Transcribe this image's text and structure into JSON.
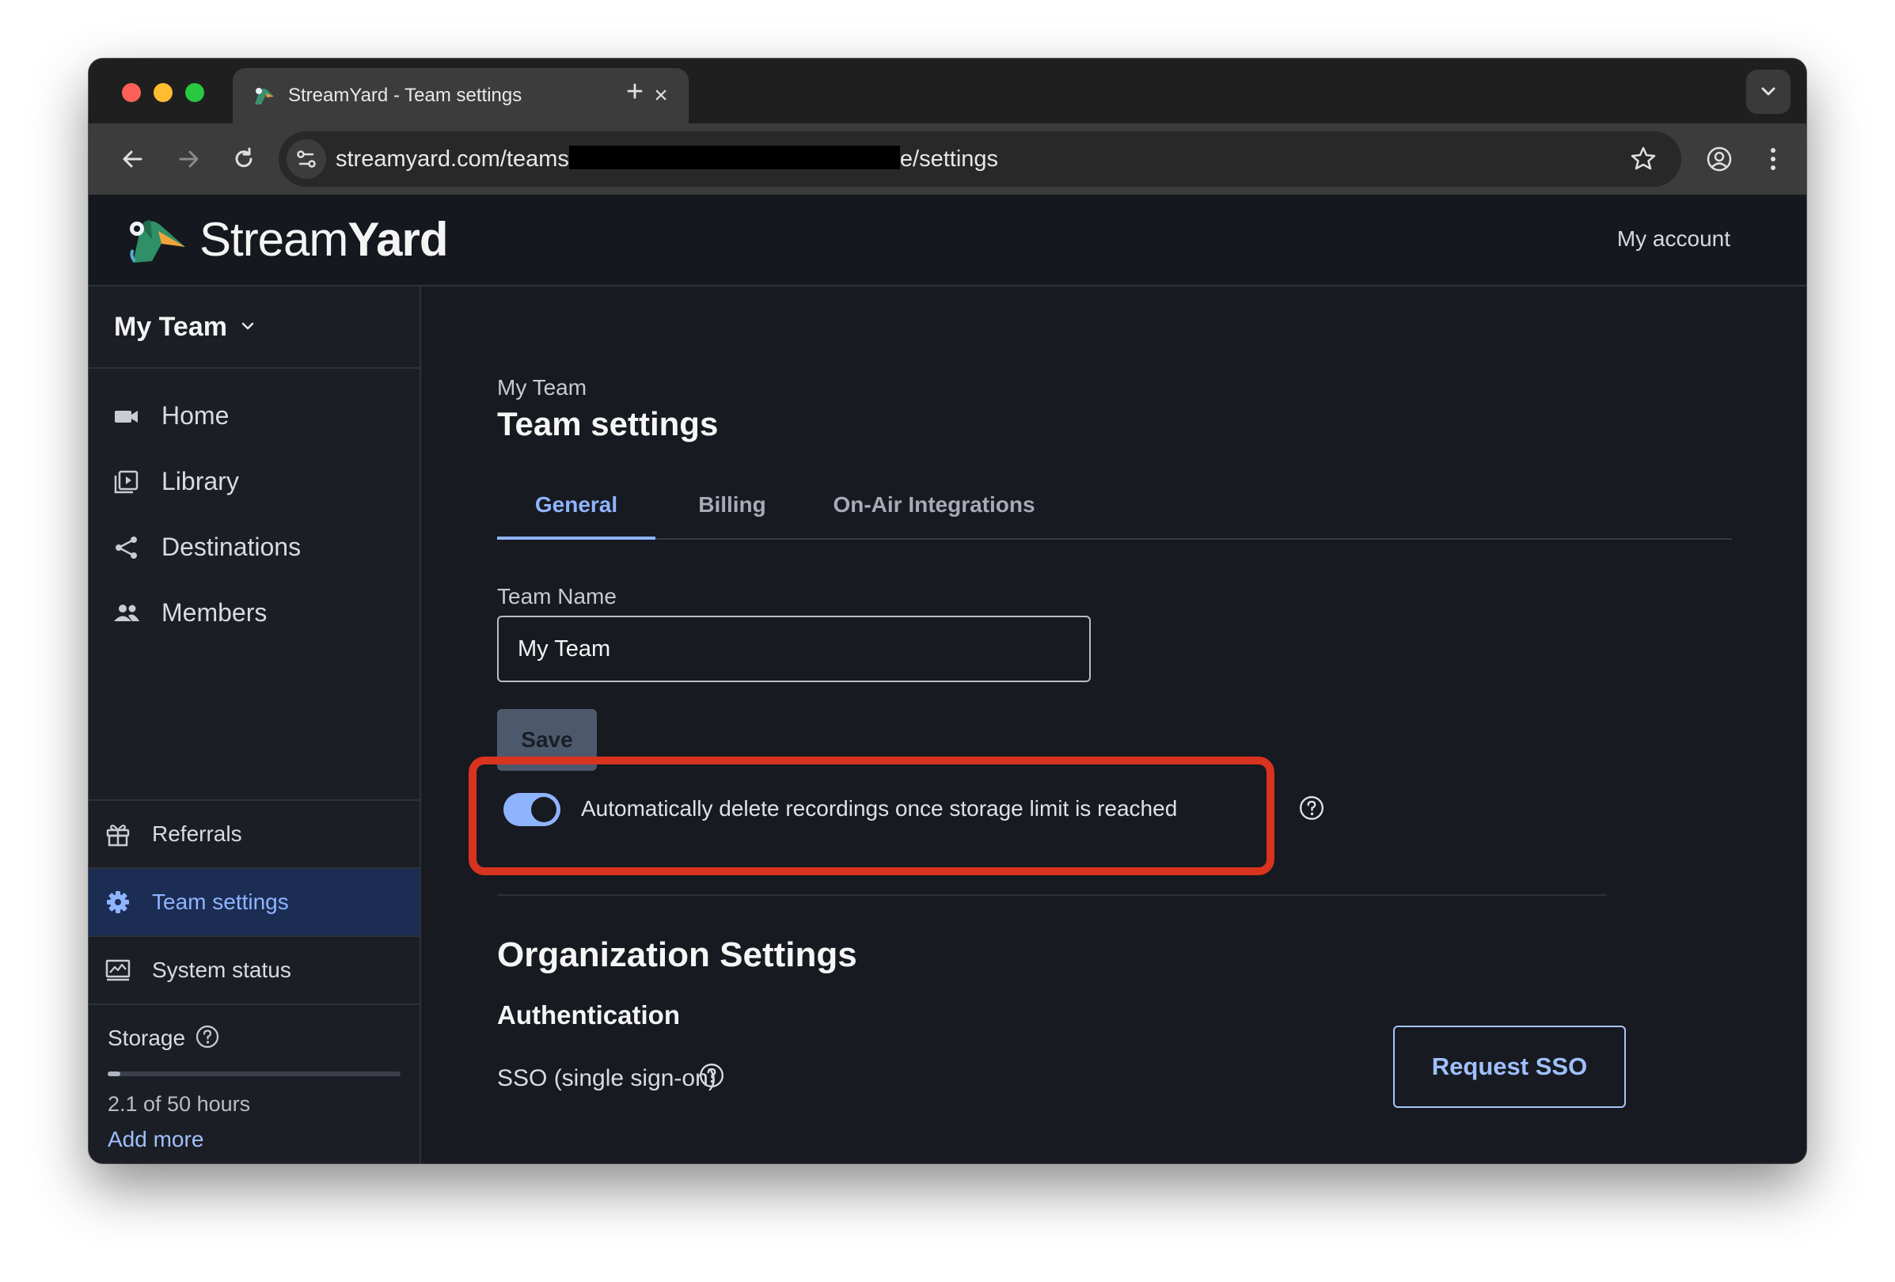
{
  "browser": {
    "tab_title": "StreamYard - Team settings",
    "close_glyph": "×",
    "new_tab_glyph": "+",
    "url_prefix": "streamyard.com/teams",
    "url_suffix": "e/settings"
  },
  "header": {
    "brand_light": "Stream",
    "brand_bold": "Yard",
    "account_link": "My account"
  },
  "sidebar": {
    "team_name": "My Team",
    "items": [
      {
        "label": "Home",
        "icon": "video-camera-icon"
      },
      {
        "label": "Library",
        "icon": "library-icon"
      },
      {
        "label": "Destinations",
        "icon": "share-icon"
      },
      {
        "label": "Members",
        "icon": "people-icon"
      }
    ],
    "bottom_items": [
      {
        "label": "Referrals",
        "icon": "gift-icon"
      },
      {
        "label": "Team settings",
        "icon": "gear-icon",
        "active": true
      },
      {
        "label": "System status",
        "icon": "monitor-chart-icon"
      }
    ],
    "storage": {
      "title": "Storage",
      "usage_text": "2.1 of 50 hours",
      "used_fraction": 0.042,
      "add_more": "Add more"
    }
  },
  "main": {
    "breadcrumb": "My Team",
    "title": "Team settings",
    "tabs": [
      {
        "label": "General",
        "active": true
      },
      {
        "label": "Billing"
      },
      {
        "label": "On-Air Integrations"
      }
    ],
    "team_name_label": "Team Name",
    "team_name_value": "My Team",
    "save_label": "Save",
    "auto_delete_label": "Automatically delete recordings once storage limit is reached",
    "auto_delete_enabled": true,
    "org_title": "Organization Settings",
    "auth_title": "Authentication",
    "sso_label": "SSO (single sign-on)",
    "request_sso_label": "Request SSO"
  },
  "colors": {
    "accent": "#8fb4ff",
    "highlight_box": "#d8331f",
    "active_nav_bg": "#1c2d54"
  }
}
